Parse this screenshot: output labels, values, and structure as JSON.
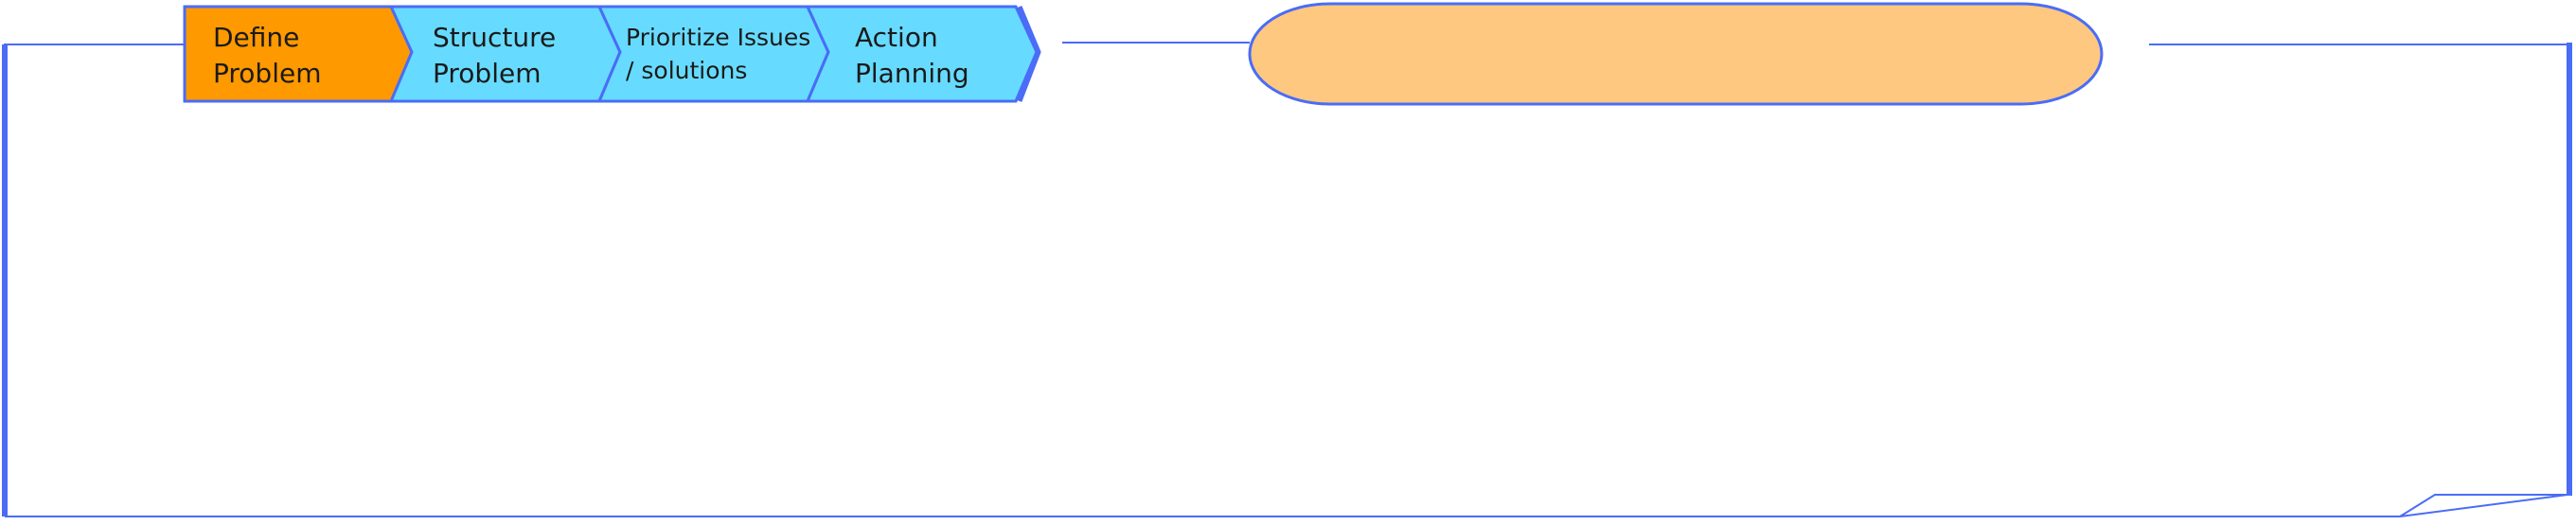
{
  "colors": {
    "frame": "#4a6cf7",
    "active_step_fill": "#ff9900",
    "step_fill": "#66dbff",
    "pill_fill": "#ffc880",
    "background": "#ffffff"
  },
  "process_steps": [
    {
      "line1": "Define",
      "line2": "Problem",
      "state": "active"
    },
    {
      "line1": "Structure",
      "line2": "Problem",
      "state": "inactive"
    },
    {
      "line1": "Prioritize Issues",
      "line2": "/ solutions",
      "state": "inactive"
    },
    {
      "line1": "Action",
      "line2": "Planning",
      "state": "inactive"
    }
  ],
  "title_pill": {
    "text": ""
  }
}
